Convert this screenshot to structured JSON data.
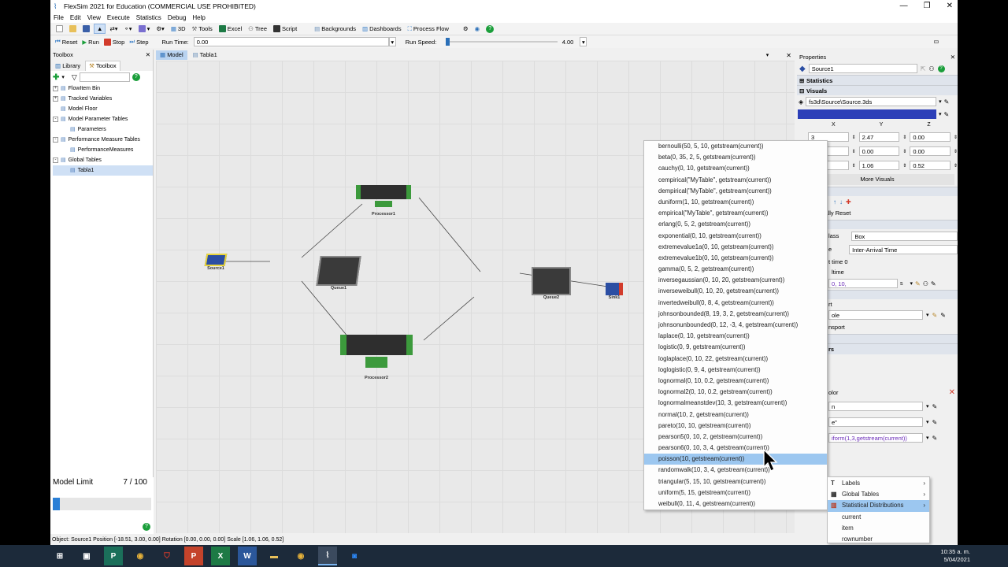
{
  "window": {
    "title": "FlexSim 2021 for Education (COMMERCIAL USE PROHIBITED)"
  },
  "menu": [
    "File",
    "Edit",
    "View",
    "Execute",
    "Statistics",
    "Debug",
    "Help"
  ],
  "toolbar": {
    "view3d": "3D",
    "tools": "Tools",
    "excel": "Excel",
    "tree": "Tree",
    "script": "Script",
    "backgrounds": "Backgrounds",
    "dashboards": "Dashboards",
    "process_flow": "Process Flow"
  },
  "runbar": {
    "reset": "Reset",
    "run": "Run",
    "stop": "Stop",
    "step": "Step",
    "run_time_label": "Run Time:",
    "run_time": "0.00",
    "run_speed_label": "Run Speed:",
    "run_speed": "4.00"
  },
  "toolbox": {
    "title": "Toolbox",
    "tab_library": "Library",
    "tab_toolbox": "Toolbox",
    "items": [
      {
        "label": "FlowItem Bin",
        "indent": 0,
        "exp": "+"
      },
      {
        "label": "Tracked Variables",
        "indent": 0,
        "exp": "+"
      },
      {
        "label": "Model Floor",
        "indent": 0,
        "exp": ""
      },
      {
        "label": "Model Parameter Tables",
        "indent": 0,
        "exp": "-"
      },
      {
        "label": "Parameters",
        "indent": 1,
        "exp": ""
      },
      {
        "label": "Performance Measure Tables",
        "indent": 0,
        "exp": "-"
      },
      {
        "label": "PerformanceMeasures",
        "indent": 1,
        "exp": ""
      },
      {
        "label": "Global Tables",
        "indent": 0,
        "exp": "-"
      },
      {
        "label": "Tabla1",
        "indent": 1,
        "exp": "",
        "selected": true
      }
    ]
  },
  "model_limit": {
    "label": "Model Limit",
    "value": "7 / 100",
    "fill": 0.07
  },
  "tabs": [
    "Model",
    "Tabla1"
  ],
  "objects": {
    "source": "Source1",
    "queue1": "Queue1",
    "processor1": "Processor1",
    "processor2": "Processor2",
    "queue2": "Queue2",
    "sink": "Sink1"
  },
  "distributions": [
    "bernoulli(50, 5, 10, getstream(current))",
    "beta(0, 35, 2, 5, getstream(current))",
    "cauchy(0, 10, getstream(current))",
    "cempirical(\"MyTable\", getstream(current))",
    "dempirical(\"MyTable\", getstream(current))",
    "duniform(1, 10, getstream(current))",
    "empirical(\"MyTable\", getstream(current))",
    "erlang(0, 5, 2, getstream(current))",
    "exponential(0, 10, getstream(current))",
    "extremevalue1a(0, 10, getstream(current))",
    "extremevalue1b(0, 10, getstream(current))",
    "gamma(0, 5, 2, getstream(current))",
    "inversegaussian(0, 10, 20, getstream(current))",
    "inverseweibull(0, 10, 20, getstream(current))",
    "invertedweibull(0, 8, 4, getstream(current))",
    "johnsonbounded(8, 19, 3, 2, getstream(current))",
    "johnsonunbounded(0, 12, -3, 4, getstream(current))",
    "laplace(0, 10, getstream(current))",
    "logistic(0, 9, getstream(current))",
    "loglaplace(0, 10, 22, getstream(current))",
    "loglogistic(0, 9, 4, getstream(current))",
    "lognormal(0, 10, 0.2, getstream(current))",
    "lognormal2(0, 10, 0.2, getstream(current))",
    "lognormalmeanstdev(10, 3, getstream(current))",
    "normal(10, 2, getstream(current))",
    "pareto(10, 10, getstream(current))",
    "pearson5(0, 10, 2, getstream(current))",
    "pearson6(0, 10, 3, 4, getstream(current))",
    "poisson(10, getstream(current))",
    "randomwalk(10, 3, 4, getstream(current))",
    "triangular(5, 15, 10, getstream(current))",
    "uniform(5, 15, getstream(current))",
    "weibull(0, 11, 4, getstream(current))"
  ],
  "selected_distribution": "poisson(10, getstream(current))",
  "submenu": [
    "Labels",
    "Global Tables",
    "Statistical Distributions",
    "current",
    "item",
    "rownumber"
  ],
  "properties": {
    "title": "Properties",
    "name": "Source1",
    "statistics": "Statistics",
    "visuals": "Visuals",
    "shape": "fs3d\\Source\\Source.3ds",
    "xyz": [
      "X",
      "Y",
      "Z"
    ],
    "pos": [
      "3",
      "2.47",
      "0.00"
    ],
    "rot": [
      "",
      "0.00",
      "0.00"
    ],
    "scale": [
      "",
      "1.06",
      "0.52"
    ],
    "more_visuals": "More Visuals",
    "reset": "ically Reset",
    "class_label": "lass",
    "class_value": "Box",
    "mode_label": "e",
    "mode_value": "Inter-Arrival Time",
    "first_time": "t time 0",
    "arrival_label": "ltime",
    "arrival_code": "0, 10, getstream(current);",
    "unit": "s",
    "port_label": "rt",
    "port_value": "ole",
    "transport": "nsport",
    "sect_rs": "rs",
    "color_label": "olor",
    "field1": "n",
    "field2": "e\"",
    "code2": "iform(1,3,getstream(current))"
  },
  "status": "Object: Source1 Position [-18.51, 3.00, 0.00]  Rotation [0.00, 0.00, 0.00]  Scale [1.06, 1.06, 0.52]",
  "clock": {
    "time": "10:35 a. m.",
    "date": "5/04/2021"
  },
  "colors": {
    "accent": "#2a6fb8",
    "selection": "#9cc7f0",
    "visual_color": "#2c3fb8"
  }
}
